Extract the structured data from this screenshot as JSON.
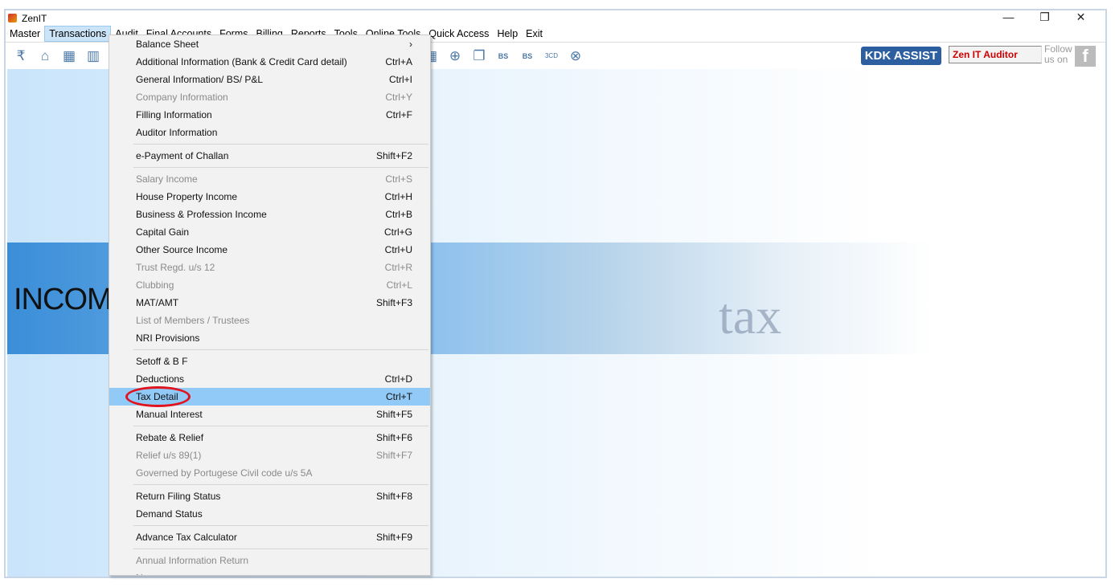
{
  "window": {
    "title": "ZenIT",
    "minimize": "—",
    "restore": "❐",
    "close": "✕"
  },
  "menubar": [
    "Master",
    "Transactions",
    "Audit",
    "Final Accounts",
    "Forms",
    "Billing",
    "Reports",
    "Tools",
    "Online Tools",
    "Quick Access",
    "Help",
    "Exit"
  ],
  "toolbar": {
    "kdk": "KDK ASSIST",
    "product": "Zen IT Auditor",
    "follow": "Follow us on",
    "fb": "f"
  },
  "banner": {
    "word": "INCOME",
    "tax": "tax"
  },
  "menu": [
    {
      "label": "Balance Sheet",
      "shortcut": "›"
    },
    {
      "label": "Additional Information (Bank & Credit Card detail)",
      "shortcut": "Ctrl+A"
    },
    {
      "label": "General Information/ BS/ P&L",
      "shortcut": "Ctrl+I"
    },
    {
      "label": "Company Information",
      "shortcut": "Ctrl+Y",
      "disabled": true
    },
    {
      "label": "Filling Information",
      "shortcut": "Ctrl+F"
    },
    {
      "label": "Auditor Information",
      "shortcut": ""
    },
    {
      "sep": true
    },
    {
      "label": "e-Payment of Challan",
      "shortcut": "Shift+F2"
    },
    {
      "sep": true
    },
    {
      "label": "Salary Income",
      "shortcut": "Ctrl+S",
      "disabled": true
    },
    {
      "label": "House Property Income",
      "shortcut": "Ctrl+H"
    },
    {
      "label": "Business & Profession Income",
      "shortcut": "Ctrl+B"
    },
    {
      "label": "Capital Gain",
      "shortcut": "Ctrl+G"
    },
    {
      "label": "Other Source Income",
      "shortcut": "Ctrl+U"
    },
    {
      "label": "Trust Regd. u/s 12",
      "shortcut": "Ctrl+R",
      "disabled": true
    },
    {
      "label": "Clubbing",
      "shortcut": "Ctrl+L",
      "disabled": true
    },
    {
      "label": "MAT/AMT",
      "shortcut": "Shift+F3"
    },
    {
      "label": "List of Members / Trustees",
      "shortcut": "",
      "disabled": true
    },
    {
      "label": "NRI Provisions",
      "shortcut": ""
    },
    {
      "sep": true
    },
    {
      "label": "Setoff & B F",
      "shortcut": ""
    },
    {
      "label": "Deductions",
      "shortcut": "Ctrl+D"
    },
    {
      "label": "Tax Detail",
      "shortcut": "Ctrl+T",
      "selected": true
    },
    {
      "label": "Manual Interest",
      "shortcut": "Shift+F5"
    },
    {
      "sep": true
    },
    {
      "label": "Rebate & Relief",
      "shortcut": "Shift+F6"
    },
    {
      "label": "Relief u/s 89(1)",
      "shortcut": "Shift+F7",
      "disabled": true
    },
    {
      "label": "Governed by Portugese Civil code u/s 5A",
      "shortcut": "",
      "disabled": true
    },
    {
      "sep": true
    },
    {
      "label": "Return Filing Status",
      "shortcut": "Shift+F8"
    },
    {
      "label": "Demand Status",
      "shortcut": ""
    },
    {
      "sep": true
    },
    {
      "label": "Advance Tax Calculator",
      "shortcut": "Shift+F9"
    },
    {
      "sep": true
    },
    {
      "label": "Annual Information Return",
      "shortcut": "",
      "disabled": true
    },
    {
      "label": "Notes",
      "shortcut": ""
    }
  ]
}
